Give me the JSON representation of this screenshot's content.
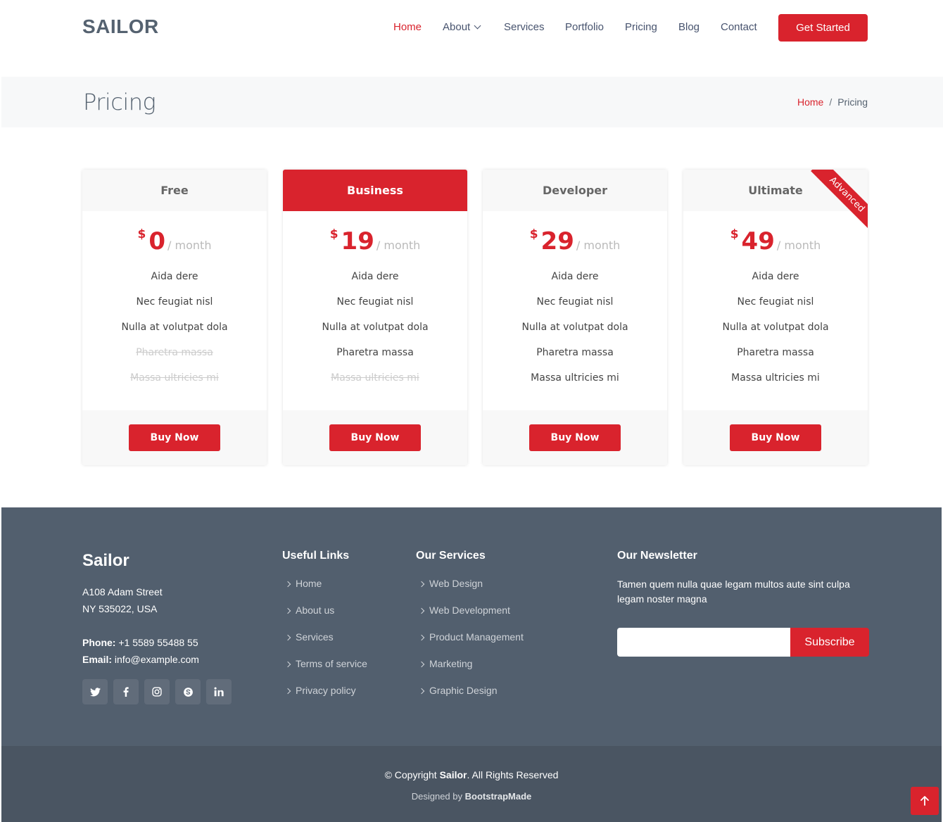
{
  "header": {
    "logo": "SAILOR",
    "nav": [
      {
        "label": "Home",
        "active": true
      },
      {
        "label": "About",
        "dropdown": true
      },
      {
        "label": "Services"
      },
      {
        "label": "Portfolio"
      },
      {
        "label": "Pricing"
      },
      {
        "label": "Blog"
      },
      {
        "label": "Contact"
      }
    ],
    "cta": "Get Started"
  },
  "breadcrumbs": {
    "title": "Pricing",
    "home": "Home",
    "separator": "/",
    "current": "Pricing"
  },
  "pricing": {
    "currency": "$",
    "period": "/ month",
    "button_label": "Buy Now",
    "plans": [
      {
        "name": "Free",
        "price": "0",
        "featured": false,
        "ribbon": "",
        "features": [
          {
            "text": "Aida dere",
            "available": true
          },
          {
            "text": "Nec feugiat nisl",
            "available": true
          },
          {
            "text": "Nulla at volutpat dola",
            "available": true
          },
          {
            "text": "Pharetra massa",
            "available": false
          },
          {
            "text": "Massa ultricies mi",
            "available": false
          }
        ]
      },
      {
        "name": "Business",
        "price": "19",
        "featured": true,
        "ribbon": "",
        "features": [
          {
            "text": "Aida dere",
            "available": true
          },
          {
            "text": "Nec feugiat nisl",
            "available": true
          },
          {
            "text": "Nulla at volutpat dola",
            "available": true
          },
          {
            "text": "Pharetra massa",
            "available": true
          },
          {
            "text": "Massa ultricies mi",
            "available": false
          }
        ]
      },
      {
        "name": "Developer",
        "price": "29",
        "featured": false,
        "ribbon": "",
        "features": [
          {
            "text": "Aida dere",
            "available": true
          },
          {
            "text": "Nec feugiat nisl",
            "available": true
          },
          {
            "text": "Nulla at volutpat dola",
            "available": true
          },
          {
            "text": "Pharetra massa",
            "available": true
          },
          {
            "text": "Massa ultricies mi",
            "available": true
          }
        ]
      },
      {
        "name": "Ultimate",
        "price": "49",
        "featured": false,
        "ribbon": "Advanced",
        "features": [
          {
            "text": "Aida dere",
            "available": true
          },
          {
            "text": "Nec feugiat nisl",
            "available": true
          },
          {
            "text": "Nulla at volutpat dola",
            "available": true
          },
          {
            "text": "Pharetra massa",
            "available": true
          },
          {
            "text": "Massa ultricies mi",
            "available": true
          }
        ]
      }
    ]
  },
  "footer": {
    "brand": "Sailor",
    "address_line1": "A108 Adam Street",
    "address_line2": "NY 535022, USA",
    "phone_label": "Phone:",
    "phone": "+1 5589 55488 55",
    "email_label": "Email:",
    "email": "info@example.com",
    "socials": [
      "twitter-icon",
      "facebook-icon",
      "instagram-icon",
      "skype-icon",
      "linkedin-icon"
    ],
    "useful_links_title": "Useful Links",
    "useful_links": [
      "Home",
      "About us",
      "Services",
      "Terms of service",
      "Privacy policy"
    ],
    "services_title": "Our Services",
    "services": [
      "Web Design",
      "Web Development",
      "Product Management",
      "Marketing",
      "Graphic Design"
    ],
    "newsletter_title": "Our Newsletter",
    "newsletter_text": "Tamen quem nulla quae legam multos aute sint culpa legam noster magna",
    "subscribe_label": "Subscribe",
    "copyright_prefix": "© Copyright",
    "copyright_brand": "Sailor",
    "copyright_suffix": ". All Rights Reserved",
    "designed_by_prefix": "Designed by",
    "designed_by": "BootstrapMade"
  },
  "colors": {
    "accent": "#d9232d",
    "footer_bg": "#525f6e",
    "footer_bottom_bg": "#4a5562"
  }
}
